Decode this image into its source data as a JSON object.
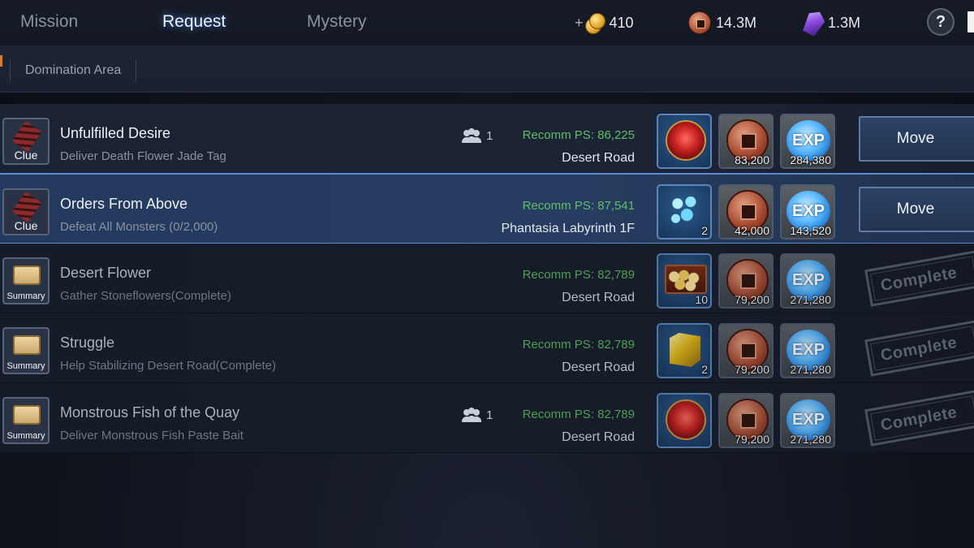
{
  "tabs": [
    {
      "label": "Mission",
      "active": false
    },
    {
      "label": "Request",
      "active": true
    },
    {
      "label": "Mystery",
      "active": false
    }
  ],
  "currencies": {
    "gold": {
      "plus": "+",
      "value": "410",
      "icon": "gold-coin-icon"
    },
    "copper": {
      "value": "14.3M",
      "icon": "copper-coin-icon"
    },
    "crystal": {
      "value": "1.3M",
      "icon": "crystal-icon"
    }
  },
  "help_label": "?",
  "subtab": "Domination Area",
  "quests": [
    {
      "icon_label": "Clue",
      "title": "Unfulfilled Desire",
      "subtitle": "Deliver Death Flower Jade Tag",
      "party_count": "1",
      "recomm": "Recomm PS: 86,225",
      "location": "Desert Road",
      "reward_item_icon": "flower-icon",
      "reward_item_count": "",
      "copper_reward": "83,200",
      "exp_label": "EXP",
      "exp_reward": "284,380",
      "action": "Move",
      "state": "active"
    },
    {
      "icon_label": "Clue",
      "title": "Orders From Above",
      "subtitle": "Defeat All Monsters (0/2,000)",
      "party_count": "",
      "recomm": "Recomm PS: 87,541",
      "location": "Phantasia Labyrinth 1F",
      "reward_item_icon": "blue-flower-icon",
      "reward_item_count": "2",
      "copper_reward": "42,000",
      "exp_label": "EXP",
      "exp_reward": "143,520",
      "action": "Move",
      "state": "selected"
    },
    {
      "icon_label": "Summary",
      "title": "Desert Flower",
      "subtitle": "Gather Stoneflowers(Complete)",
      "party_count": "",
      "recomm": "Recomm PS: 82,789",
      "location": "Desert Road",
      "reward_item_icon": "gold-box-icon",
      "reward_item_count": "10",
      "copper_reward": "79,200",
      "exp_label": "EXP",
      "exp_reward": "271,280",
      "action": "Complete",
      "state": "complete"
    },
    {
      "icon_label": "Summary",
      "title": "Struggle",
      "subtitle": "Help Stabilizing Desert Road(Complete)",
      "party_count": "",
      "recomm": "Recomm PS: 82,789",
      "location": "Desert Road",
      "reward_item_icon": "gold-cube-icon",
      "reward_item_count": "2",
      "copper_reward": "79,200",
      "exp_label": "EXP",
      "exp_reward": "271,280",
      "action": "Complete",
      "state": "complete"
    },
    {
      "icon_label": "Summary",
      "title": "Monstrous Fish of the Quay",
      "subtitle": "Deliver Monstrous Fish Paste Bait",
      "party_count": "1",
      "recomm": "Recomm PS: 82,789",
      "location": "Desert Road",
      "reward_item_icon": "flower-icon",
      "reward_item_count": "",
      "copper_reward": "79,200",
      "exp_label": "EXP",
      "exp_reward": "271,280",
      "action": "Complete",
      "state": "complete"
    }
  ]
}
